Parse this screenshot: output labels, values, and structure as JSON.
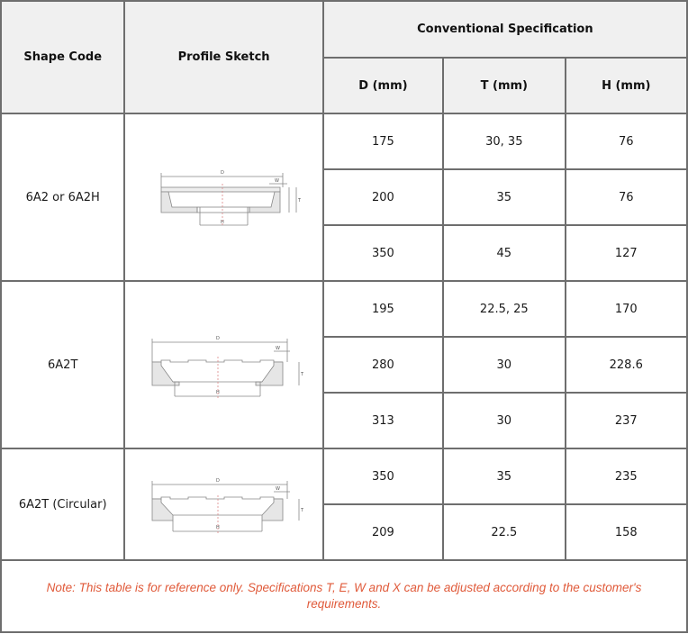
{
  "headers": {
    "shape_code": "Shape Code",
    "profile_sketch": "Profile Sketch",
    "conventional_specification": "Conventional Specification",
    "d": "D (mm)",
    "t": "T (mm)",
    "h": "H (mm)"
  },
  "groups": [
    {
      "shape_code": "6A2 or 6A2H",
      "sketch_icon": "cup-wheel-6a2-profile",
      "rows": [
        {
          "d": "175",
          "t": "30, 35",
          "h": "76"
        },
        {
          "d": "200",
          "t": "35",
          "h": "76"
        },
        {
          "d": "350",
          "t": "45",
          "h": "127"
        }
      ]
    },
    {
      "shape_code": "6A2T",
      "sketch_icon": "cup-wheel-6a2t-profile",
      "rows": [
        {
          "d": "195",
          "t": "22.5, 25",
          "h": "170"
        },
        {
          "d": "280",
          "t": "30",
          "h": "228.6"
        },
        {
          "d": "313",
          "t": "30",
          "h": "237"
        }
      ]
    },
    {
      "shape_code": "6A2T (Circular)",
      "sketch_icon": "cup-wheel-6a2t-circular-profile",
      "rows": [
        {
          "d": "350",
          "t": "35",
          "h": "235"
        },
        {
          "d": "209",
          "t": "22.5",
          "h": "158"
        }
      ]
    }
  ],
  "sketch_labels": {
    "d": "D",
    "h": "H",
    "w": "W",
    "t": "T"
  },
  "note": "Note: This table is for reference only.  Specifications T, E, W and X can be adjusted according to the customer's requirements.",
  "colors": {
    "note": "#e05a3a",
    "header_bg": "#f0f0f0",
    "border": "#6e6e6e"
  }
}
